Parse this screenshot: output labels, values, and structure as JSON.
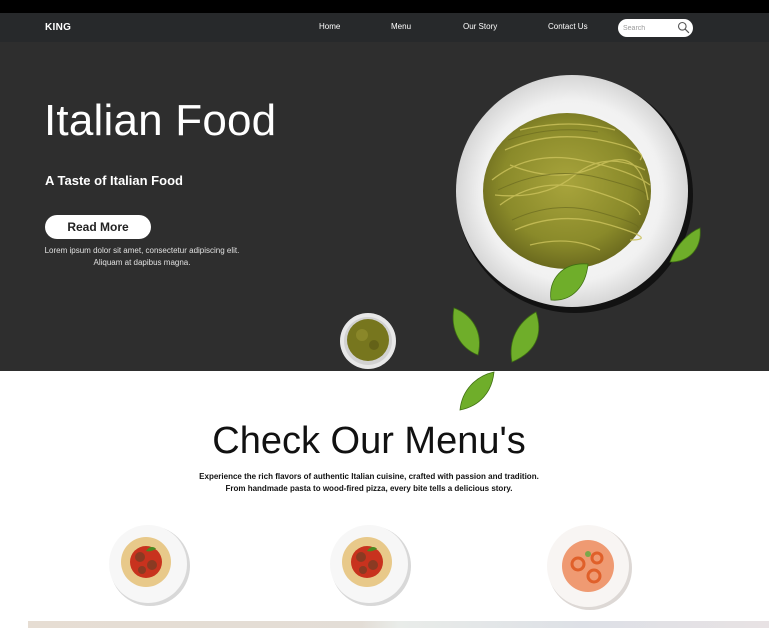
{
  "nav": {
    "brand": "KING",
    "links": [
      "Home",
      "Menu",
      "Our Story",
      "Contact Us"
    ],
    "search_placeholder": "Search"
  },
  "hero": {
    "title": "Italian Food",
    "subtitle": "A Taste of Italian Food",
    "button_label": "Read More",
    "description_line1": "Lorem ipsum dolor sit amet, consectetur adipiscing elit.",
    "description_line2": "Aliquam at dapibus magna."
  },
  "menu_section": {
    "title": "Check Our Menu's",
    "description_line1": "Experience the rich flavors of authentic Italian cuisine, crafted with passion and tradition.",
    "description_line2": "From handmade pasta to wood-fired pizza, every bite tells a delicious story."
  },
  "dishes": [
    {
      "icon": "spaghetti-meatballs-icon"
    },
    {
      "icon": "spaghetti-meatballs-icon"
    },
    {
      "icon": "shrimp-pasta-icon"
    }
  ],
  "colors": {
    "navbar": "#27292b",
    "hero_bg": "#2e2e2e",
    "pesto": "#8c8a2c",
    "leaf": "#6fae2a"
  }
}
